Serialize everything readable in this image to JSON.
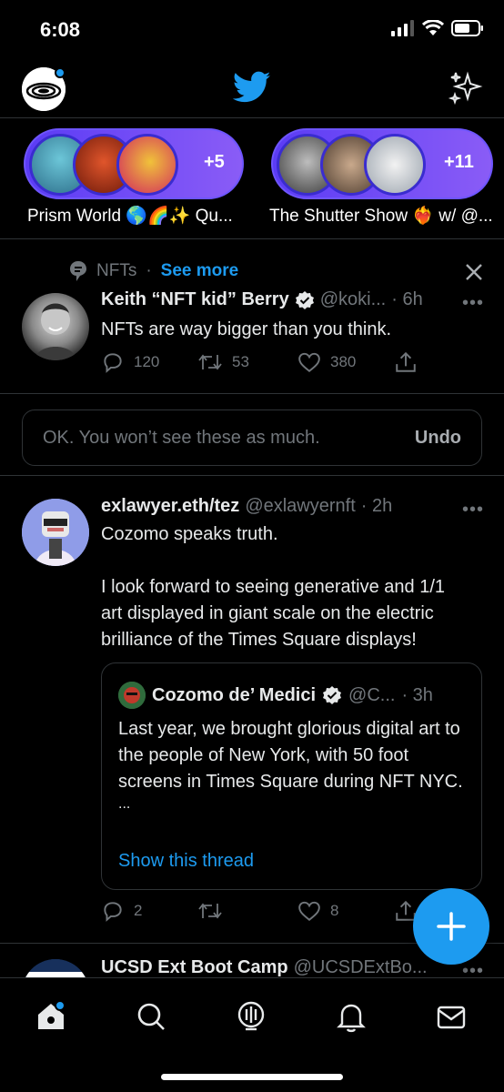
{
  "status": {
    "time": "6:08"
  },
  "spaces": [
    {
      "count": "+5",
      "title": "Prism World 🌎🌈✨ Qu..."
    },
    {
      "count": "+11",
      "title": "The Shutter Show ❤️‍🔥 w/ @..."
    }
  ],
  "topic": {
    "label": "NFTs",
    "separator": "·",
    "see_more": "See more"
  },
  "tweet1": {
    "name": "Keith “NFT kid” Berry",
    "handle": "@koki...",
    "time": "· 6h",
    "text": "NFTs are way bigger than you think.",
    "replies": "120",
    "retweets": "53",
    "likes": "380"
  },
  "undo": {
    "message": "OK. You won’t see these as much.",
    "button": "Undo"
  },
  "tweet2": {
    "name": "exlawyer.eth/tez",
    "handle": "@exlawyernft",
    "time": "· 2h",
    "text_line1": "Cozomo speaks truth.",
    "text_para2": "I look forward to seeing generative and 1/1 art displayed in giant scale on the electric brilliance of the Times Square displays!",
    "replies": "2",
    "retweets": "",
    "likes": "8"
  },
  "quote": {
    "name": "Cozomo de’ Medici",
    "handle": "@C...",
    "time": "· 3h",
    "text": "Last year, we brought glorious digital art to the people of New York, with 50 foot screens in Times Square during NFT NYC.",
    "ellipsis": "...",
    "link": "Show this thread"
  },
  "tweet3": {
    "name": "UCSD Ext Boot Camp",
    "handle": "@UCSDExtBo..."
  },
  "more_dots": "•••",
  "colors": {
    "accent": "#1d9bf0",
    "background": "#000000",
    "muted": "#71767b",
    "spaces_purple": "#6e55ff"
  },
  "icons": [
    "twitter-bird-icon",
    "sparkle-icon",
    "topic-icon",
    "close-icon",
    "reply-icon",
    "retweet-icon",
    "like-icon",
    "share-icon",
    "verified-icon",
    "compose-plus-icon",
    "home-icon",
    "search-icon",
    "spaces-icon",
    "bell-icon",
    "mail-icon"
  ]
}
